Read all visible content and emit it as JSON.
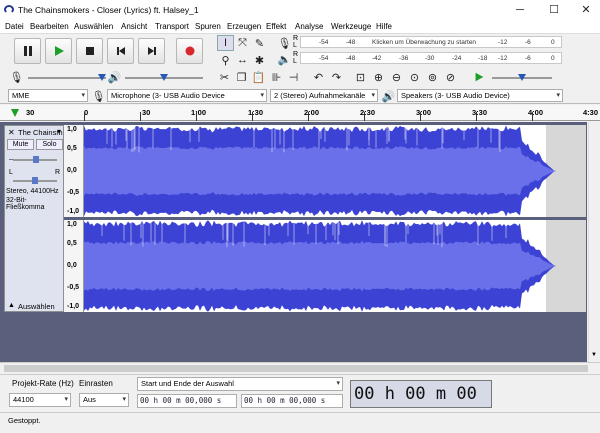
{
  "window": {
    "title": "The Chainsmokers - Closer (Lyrics) ft. Halsey_1",
    "minimize": "─",
    "maximize": "☐",
    "close": "✕"
  },
  "menu": [
    "Datei",
    "Bearbeiten",
    "Auswählen",
    "Ansicht",
    "Transport",
    "Spuren",
    "Erzeugen",
    "Effekt",
    "Analyse",
    "Werkzeuge",
    "Hilfe"
  ],
  "meters": {
    "rec_scale": [
      "-54",
      "-48",
      "-12",
      "-6",
      "0"
    ],
    "rec_hint": "Klicken um Überwachung zu starten",
    "play_scale": [
      "-54",
      "-48",
      "-42",
      "-36",
      "-30",
      "-24",
      "-18",
      "-12",
      "-6",
      "0"
    ],
    "rec_label": "R",
    "l_label": "L"
  },
  "device": {
    "host": "MME",
    "input": "Microphone (3- USB Audio Device",
    "channels": "2 (Stereo) Aufnahmekanäle",
    "output": "Speakers (3- USB Audio Device)"
  },
  "ruler": {
    "labels": [
      "30",
      "0",
      "30",
      "1:00",
      "1:30",
      "2:00",
      "2:30",
      "3:00",
      "3:30",
      "4:00",
      "4:30"
    ]
  },
  "track": {
    "name": "The Chainsm",
    "mute": "Mute",
    "solo": "Solo",
    "l": "L",
    "r": "R",
    "info1": "Stereo, 44100Hz",
    "info2": "32-Bit-Fließkomma",
    "select": "Auswählen",
    "close": "✕",
    "menu": "▾",
    "collapse": "▲"
  },
  "axis": {
    "top": "1,0",
    "mid": "0,0",
    "bot": "-1,0",
    "a": "0,5",
    "b": "-0,5"
  },
  "selection": {
    "rate_label": "Projekt-Rate (Hz)",
    "rate": "44100",
    "snap_label": "Einrasten",
    "snap": "Aus",
    "mode": "Start und Ende der Auswahl",
    "start": "00 h 00 m 00,000 s",
    "end": "00 h 00 m 00,000 s",
    "big": "00 h 00 m 00 s"
  },
  "status": "Gestoppt.",
  "colors": {
    "wave": "#3b42d4",
    "wave_rms": "#6a70ea",
    "accent": "#2758b8"
  }
}
